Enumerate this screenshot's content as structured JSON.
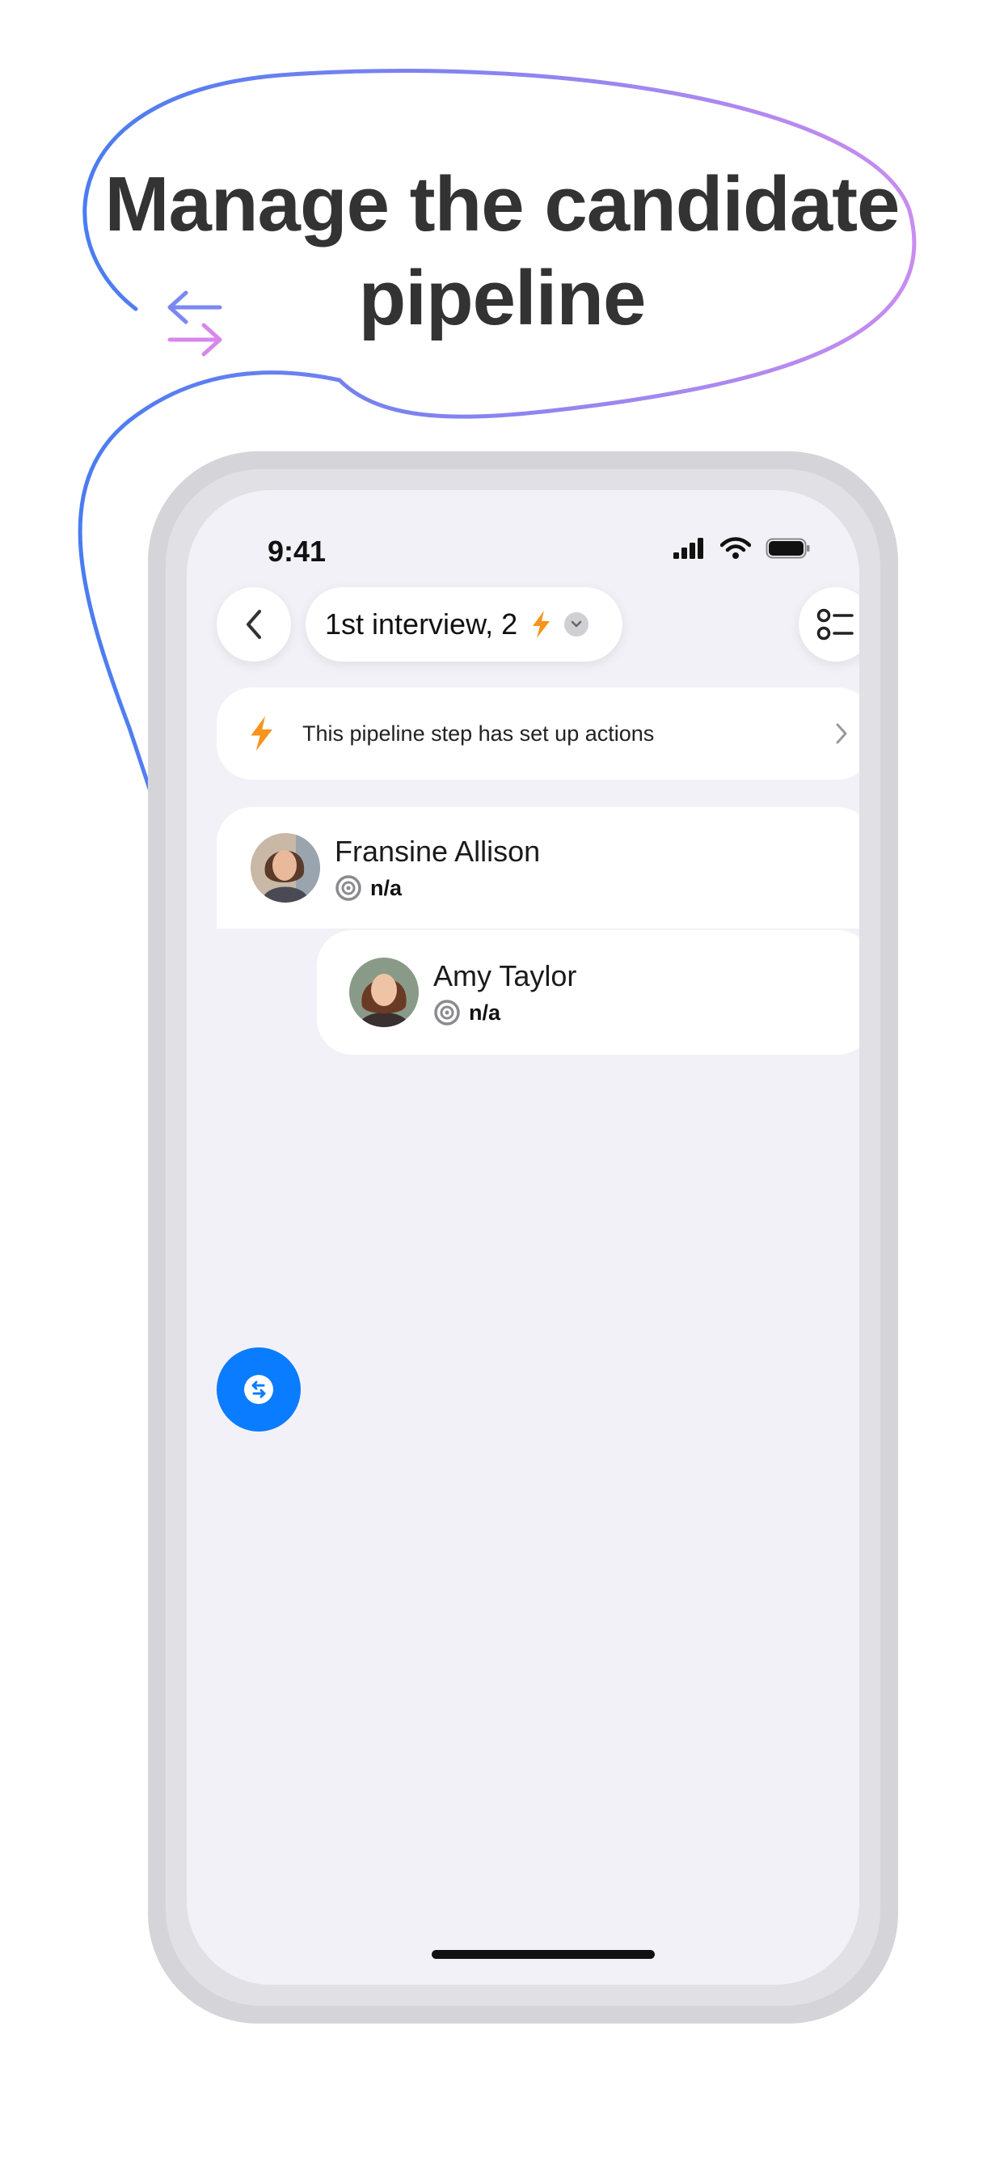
{
  "headline": {
    "line1": "Manage the candidate",
    "line2": "pipeline"
  },
  "status_bar": {
    "time": "9:41"
  },
  "header": {
    "stage_label": "1st interview, 2"
  },
  "banner": {
    "text": "This pipeline step has set up actions"
  },
  "candidates": [
    {
      "name": "Fransine Allison",
      "score": "n/a"
    },
    {
      "name": "Amy Taylor",
      "score": "n/a"
    }
  ],
  "colors": {
    "accent": "#0a7cff",
    "lightning": "#f7941d",
    "curve_start": "#4a7cf0",
    "curve_end": "#c98cf0"
  },
  "icons": {
    "back": "chevron-left-icon",
    "stage_flag": "lightning-icon",
    "dropdown": "chevron-down-icon",
    "list": "list-view-icon",
    "banner": "lightning-icon",
    "banner_arrow": "chevron-right-icon",
    "score": "target-icon",
    "move": "swap-arrows-icon"
  }
}
